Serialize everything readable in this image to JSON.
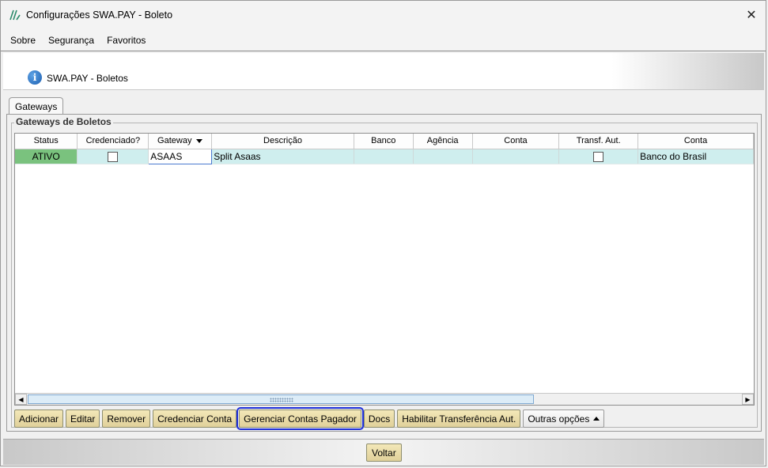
{
  "window": {
    "title": "Configurações SWA.PAY - Boleto",
    "close_glyph": "✕"
  },
  "menu": [
    {
      "label": "Sobre"
    },
    {
      "label": "Segurança"
    },
    {
      "label": "Favoritos"
    }
  ],
  "header": {
    "icon": "info-icon",
    "icon_glyph": "i",
    "title": "SWA.PAY - Boletos"
  },
  "tabs": [
    {
      "label": "Gateways",
      "active": true
    }
  ],
  "group": {
    "title": "Gateways de Boletos"
  },
  "grid": {
    "columns": [
      "Status",
      "Credenciado?",
      "Gateway",
      "Descrição",
      "Banco",
      "Agência",
      "Conta",
      "Transf. Aut.",
      "Conta"
    ],
    "rows": [
      {
        "status": "ATIVO",
        "credenciado": false,
        "gateway": "ASAAS",
        "descricao": "Split Asaas",
        "banco": "",
        "agencia": "",
        "conta": "",
        "transf_aut": false,
        "conta2": "Banco do Brasil"
      }
    ],
    "status_color": "#7ac27e",
    "row_color": "#cfeeee",
    "hscroll_thumb_fraction": 0.71
  },
  "actions": [
    {
      "label": "Adicionar"
    },
    {
      "label": "Editar"
    },
    {
      "label": "Remover"
    },
    {
      "label": "Credenciar Conta"
    },
    {
      "label": "Gerenciar Contas Pagador",
      "selected": true
    },
    {
      "label": "Docs"
    },
    {
      "label": "Habilitar Transferência Aut."
    },
    {
      "label": "Outras opções"
    }
  ],
  "footer": {
    "back_label": "Voltar"
  },
  "colors": {
    "button_bg": "#e8dca8",
    "selection_outline": "#1f2fd8",
    "status_active": "#7ac27e"
  }
}
